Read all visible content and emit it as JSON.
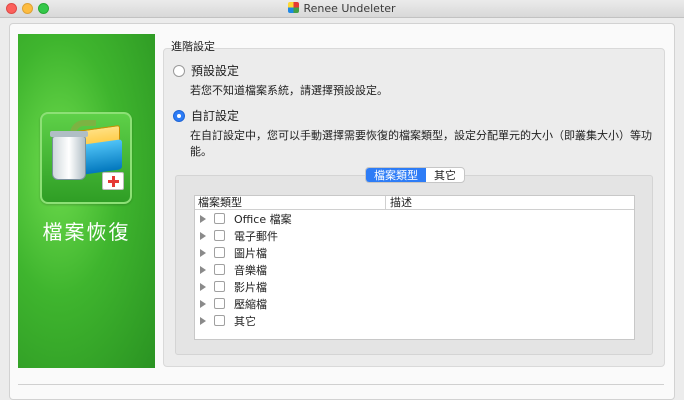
{
  "window": {
    "title": "Renee Undeleter"
  },
  "sidebar": {
    "label": "檔案恢復",
    "icon": "file-recovery-icon"
  },
  "settings": {
    "group_label": "進階設定",
    "default_option": {
      "label": "預設設定",
      "description": "若您不知道檔案系統，請選擇預設設定。",
      "selected": false
    },
    "custom_option": {
      "label": "自訂設定",
      "description_line1": "在自訂設定中，您可以手動選擇需要恢復的檔案類型，設定分配單元的大小（即叢集大小）等功",
      "description_line2": "能。",
      "selected": true
    }
  },
  "tabs": [
    {
      "label": "檔案類型",
      "active": true
    },
    {
      "label": "其它",
      "active": false
    }
  ],
  "file_table": {
    "columns": [
      "檔案類型",
      "描述"
    ],
    "rows": [
      {
        "label": "Office 檔案",
        "checked": false
      },
      {
        "label": "電子郵件",
        "checked": false
      },
      {
        "label": "圖片檔",
        "checked": false
      },
      {
        "label": "音樂檔",
        "checked": false
      },
      {
        "label": "影片檔",
        "checked": false
      },
      {
        "label": "壓縮檔",
        "checked": false
      },
      {
        "label": "其它",
        "checked": false
      }
    ]
  },
  "colors": {
    "accent": "#2d7cf6",
    "sidebar_green": "#3fb52e"
  }
}
